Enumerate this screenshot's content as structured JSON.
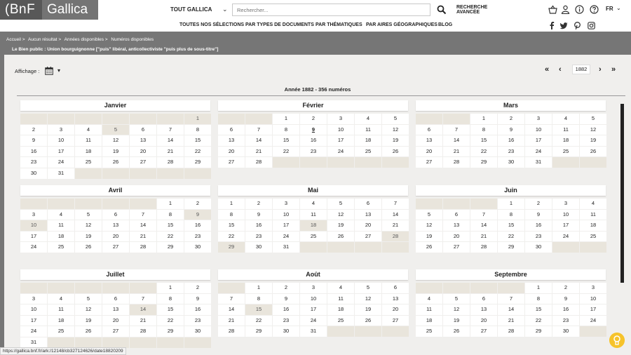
{
  "header": {
    "logo_bnf": "(BnF",
    "logo_gallica": "Gallica",
    "scope": "TOUT GALLICA",
    "search_placeholder": "Rechercher...",
    "advanced_line1": "RECHERCHE",
    "advanced_line2": "AVANCÉE",
    "lang": "FR"
  },
  "nav": {
    "items": [
      "TOUTES NOS SÉLECTIONS",
      "PAR TYPES DE DOCUMENTS",
      "PAR THÉMATIQUES",
      "PAR AIRES GÉOGRAPHIQUES",
      "BLOG"
    ]
  },
  "breadcrumb": [
    "Accueil >",
    "Aucun résultat >",
    "Années disponibles >",
    "Numéros disponibles"
  ],
  "doc_title": "Le Bien public : Union bourguignonne [\"puis\" libéral, anticollectiviste \"puis plus de sous-titre\"]",
  "toolbar": {
    "affichage": "Affichage :",
    "year": "1882"
  },
  "year_title": "Année 1882 - 356 numéros",
  "status_url": "https://gallica.bnf.fr/ark:/12148/cb327124626/date18820209",
  "months": [
    {
      "name": "Janvier",
      "offset": 6,
      "days": 31,
      "missing": [
        1,
        5
      ],
      "current": 0
    },
    {
      "name": "Février",
      "offset": 2,
      "days": 28,
      "missing": [],
      "current": 9
    },
    {
      "name": "Mars",
      "offset": 2,
      "days": 31,
      "missing": [],
      "current": 0
    },
    {
      "name": "Avril",
      "offset": 5,
      "days": 30,
      "missing": [
        9,
        10
      ],
      "current": 0
    },
    {
      "name": "Mai",
      "offset": 0,
      "days": 31,
      "missing": [
        18,
        28,
        29
      ],
      "current": 0
    },
    {
      "name": "Juin",
      "offset": 3,
      "days": 30,
      "missing": [],
      "current": 0
    },
    {
      "name": "Juillet",
      "offset": 5,
      "days": 31,
      "missing": [
        14
      ],
      "current": 0
    },
    {
      "name": "Août",
      "offset": 1,
      "days": 31,
      "missing": [
        15
      ],
      "current": 0
    },
    {
      "name": "Septembre",
      "offset": 4,
      "days": 30,
      "missing": [],
      "current": 0
    }
  ],
  "colors": {
    "logo_dark": "#585858",
    "logo_light": "#747474",
    "banner": "#767676",
    "empty_cell": "#e9e5dc",
    "help_button": "#f6c32b"
  }
}
